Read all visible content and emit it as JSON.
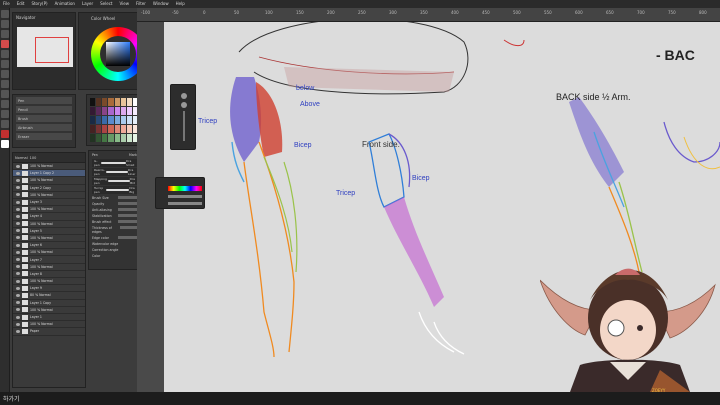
{
  "menubar": {
    "items": [
      "File",
      "Edit",
      "Story(P)",
      "Animation",
      "Layer",
      "Select",
      "View",
      "Filter",
      "Window",
      "Help"
    ]
  },
  "ruler": {
    "ticks": [
      "-100",
      "-50",
      "0",
      "50",
      "100",
      "150",
      "200",
      "250",
      "300",
      "350",
      "400",
      "450",
      "500",
      "550",
      "600",
      "650",
      "700",
      "750",
      "800"
    ]
  },
  "navigator": {
    "title": "Navigator"
  },
  "color_wheel": {
    "title": "Color Wheel"
  },
  "subtool": {
    "rows": [
      "Pen",
      "Pencil",
      "Brush",
      "Airbrush",
      "Eraser"
    ]
  },
  "swatch_colors": [
    "#111111",
    "#553322",
    "#7a4a2a",
    "#a86a3a",
    "#cc9966",
    "#e8c49a",
    "#f2ddc4",
    "#ffffff",
    "#331a33",
    "#5a2a5a",
    "#884488",
    "#aa66cc",
    "#cc88ee",
    "#ddaaee",
    "#eeccff",
    "#f7eeff",
    "#1a2a44",
    "#2a4a77",
    "#3a6aaa",
    "#5a8acc",
    "#7aaadd",
    "#aaccee",
    "#cce0f5",
    "#e6f0fa",
    "#442222",
    "#773333",
    "#aa4444",
    "#cc6655",
    "#dd8877",
    "#eeaa99",
    "#f5ccbb",
    "#fae6dd",
    "#223322",
    "#335533",
    "#447744",
    "#669966",
    "#88bb88",
    "#aaccaa",
    "#cce6cc",
    "#e6f5e6"
  ],
  "layer_panel": {
    "toolbar": [
      "Normal",
      "100"
    ],
    "layers": [
      "100 % Normal",
      "Layer 1 Copy 2",
      "100 % Normal",
      "Layer 2 Copy",
      "100 % Normal",
      "Layer 3",
      "100 % Normal",
      "Layer 4",
      "100 % Normal",
      "Layer 5",
      "100 % Normal",
      "Layer 6",
      "100 % Normal",
      "Layer 7",
      "100 % Normal",
      "Layer 8",
      "100 % Normal",
      "Layer 9",
      "80 % Normal",
      "Layer 1 Copy",
      "100 % Normal",
      "Layer 1",
      "100 % Normal",
      "Paper"
    ],
    "selected_index": 1
  },
  "brush_panel": {
    "tabs": [
      "Pen",
      "Marker"
    ],
    "brushes": [
      {
        "name": "G-pen",
        "size": "Dra Small"
      },
      {
        "name": "Real G-pen",
        "size": "Dra Liner"
      },
      {
        "name": "Mapping pen",
        "size": "Dra Mid"
      },
      {
        "name": "Turnip pen",
        "size": "Dra Big"
      }
    ],
    "props": [
      "Brush Size",
      "Opacity",
      "Anti-aliasing",
      "Stabilization",
      "Brush effect",
      "Thickness of edges",
      "Edge color"
    ],
    "options": [
      "Watercolor edge",
      "Correction angle",
      "Color"
    ]
  },
  "canvas_notes": {
    "below": "below",
    "above": "Above",
    "tricep_left": "Tricep",
    "bicep_left": "Bicep",
    "front_side": "Front side.",
    "tricep_mid": "Tricep",
    "bicep_mid": "Bicep",
    "back_side": "BACK side ½ Arm.",
    "corner": "- BAC"
  },
  "overlay": {
    "badge": "ZOEYY"
  },
  "taskbar": {
    "label": "하가기"
  }
}
